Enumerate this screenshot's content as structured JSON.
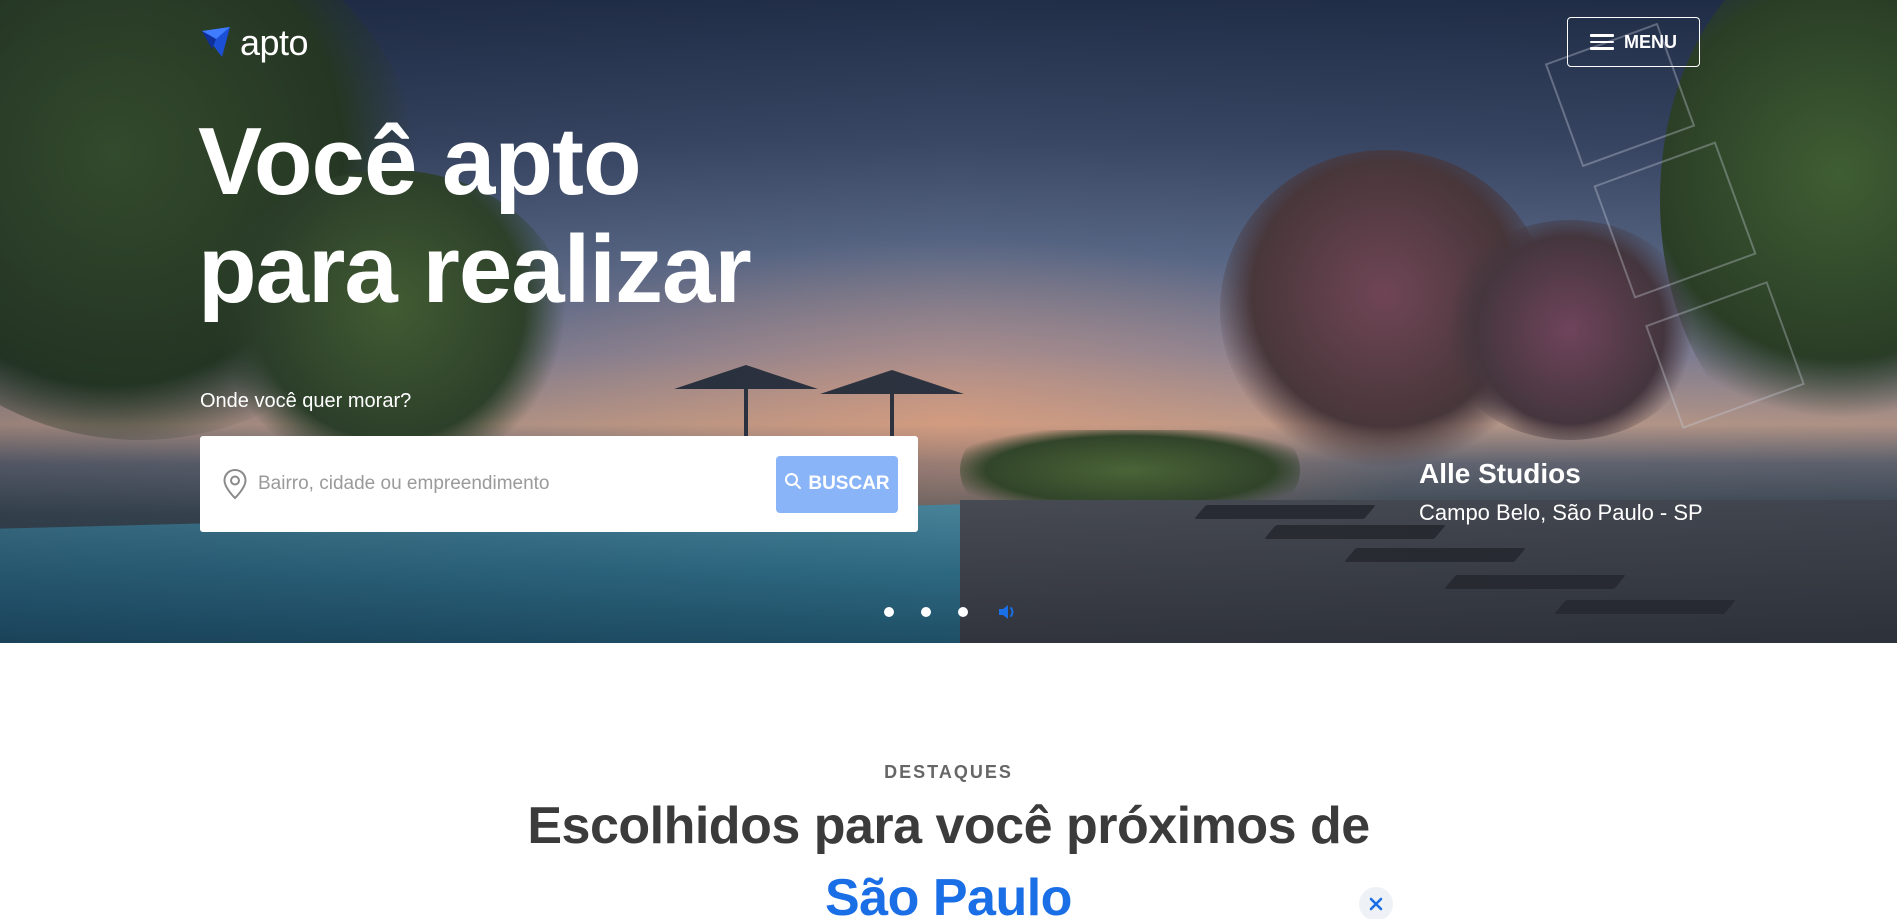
{
  "header": {
    "logo_text": "apto",
    "logo_icon": "apto-logo-icon",
    "menu_label": "MENU",
    "menu_icon": "hamburger-icon"
  },
  "hero": {
    "title_line1": "Você apto",
    "title_line2": "para realizar",
    "search_label": "Onde você quer morar?",
    "search_placeholder": "Bairro, cidade ou empreendimento",
    "search_value": "",
    "search_button": "BUSCAR",
    "search_icon": "search-icon",
    "pin_icon": "location-pin-icon",
    "property": {
      "name": "Alle Studios",
      "location": "Campo Belo, São Paulo - SP"
    },
    "carousel": {
      "dots": 3,
      "sound_icon": "sound-icon"
    }
  },
  "featured": {
    "eyebrow": "DESTAQUES",
    "title": "Escolhidos para você próximos de",
    "city": "São Paulo",
    "clear_icon": "close-icon"
  },
  "colors": {
    "accent": "#1a6ee6",
    "search_button": "#8ab4f8",
    "logo_blue": "#1a4fd6"
  }
}
